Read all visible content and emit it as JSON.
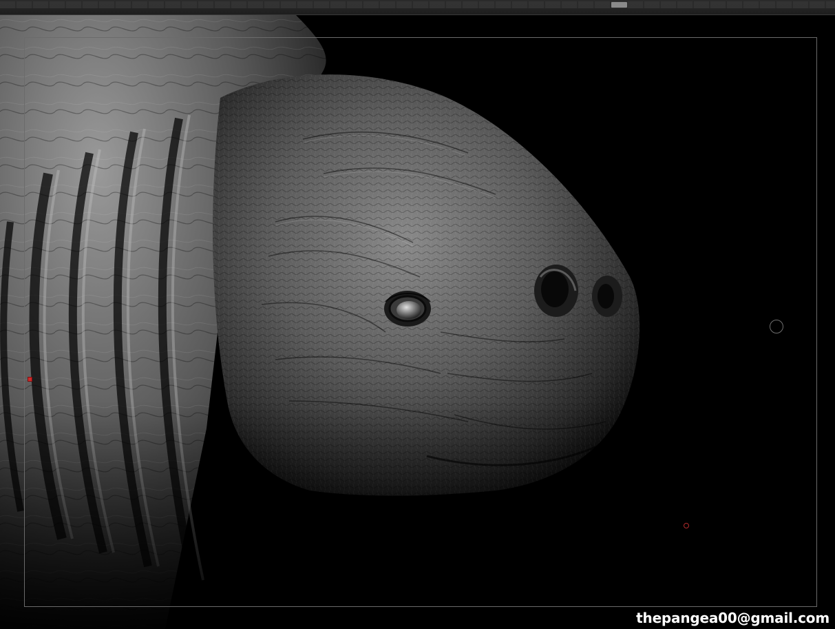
{
  "app": {
    "watermark": "thepangea00@gmail.com"
  },
  "viewport": {
    "subject_icon": "sculpted-creature-head",
    "background_color": "#000000",
    "frame_color": "#6b6b6b"
  },
  "markers": {
    "orbit_handle_icon": "circle-ring-icon",
    "left_marker_icon": "red-square-icon",
    "dot_marker_icon": "red-ring-icon",
    "marker_color": "#d02a2a"
  }
}
